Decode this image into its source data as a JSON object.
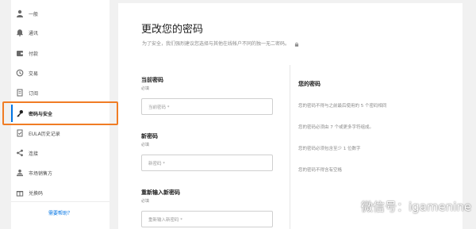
{
  "sidebar": {
    "items": [
      {
        "label": "一般",
        "icon": "user-icon"
      },
      {
        "label": "通讯",
        "icon": "bell-icon"
      },
      {
        "label": "付款",
        "icon": "wallet-icon"
      },
      {
        "label": "交易",
        "icon": "history-icon"
      },
      {
        "label": "订阅",
        "icon": "document-icon"
      },
      {
        "label": "密码与安全",
        "icon": "key-icon",
        "active": true
      },
      {
        "label": "EULA历史记录",
        "icon": "eula-icon"
      },
      {
        "label": "连接",
        "icon": "share-icon"
      },
      {
        "label": "市场销售方",
        "icon": "seller-icon"
      },
      {
        "label": "兑换码",
        "icon": "gift-icon"
      }
    ],
    "help_link": "需要帮助？"
  },
  "main": {
    "title": "更改您的密码",
    "subtitle": "为了安全，我们强烈建议您选择与其他在线帐户不同的独一无二密码。",
    "fields": [
      {
        "label": "当前密码",
        "required": "必填",
        "placeholder": "当前密码 *"
      },
      {
        "label": "新密码",
        "required": "必填",
        "placeholder": "新密码 *"
      },
      {
        "label": "重新输入新密码",
        "required": "必填",
        "placeholder": "重新输入新密码 *"
      }
    ],
    "rules": {
      "title": "您的密码",
      "items": [
        "您的密码不得与之前最后使用的 5 个密码相同",
        "您的密码必须由 7 个或更多字符组成。",
        "您的密码必须包含至少 1 位数字",
        "您的密码不得含有空格"
      ]
    }
  },
  "watermark": {
    "text": "微信号：igamenine"
  },
  "colors": {
    "accent": "#0074e4",
    "highlight": "#f07c24"
  }
}
